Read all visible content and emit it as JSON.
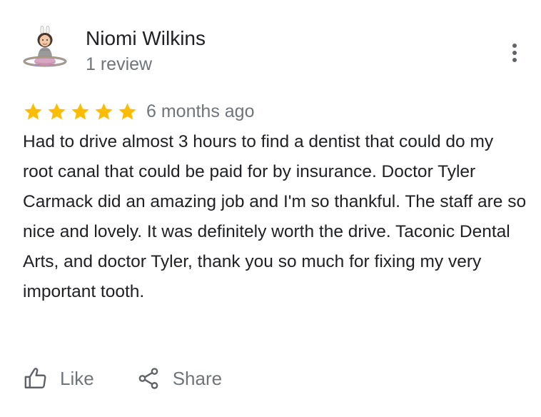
{
  "reviewer": {
    "name": "Niomi Wilkins",
    "review_count": "1 review",
    "avatar_icon": "bitmoji-avatar-on-planet"
  },
  "menu": {
    "icon": "more-vertical-icon"
  },
  "rating": {
    "stars": 5,
    "max_stars": 5,
    "star_color": "#fbbc04",
    "time": "6 months ago"
  },
  "review": {
    "text": "Had to drive almost 3 hours to find a dentist that could do my root canal that could be paid for by insurance. Doctor Tyler Carmack did an amazing job and I'm so thankful. The staff are so nice and lovely. It was definitely worth the drive. Taconic Dental Arts, and doctor Tyler, thank you so much for fixing my very important tooth."
  },
  "actions": {
    "like_label": "Like",
    "like_icon": "thumbs-up-icon",
    "share_label": "Share",
    "share_icon": "share-icon"
  },
  "colors": {
    "primary_text": "#202124",
    "secondary_text": "#70757a",
    "icon_gray": "#5f6368"
  }
}
